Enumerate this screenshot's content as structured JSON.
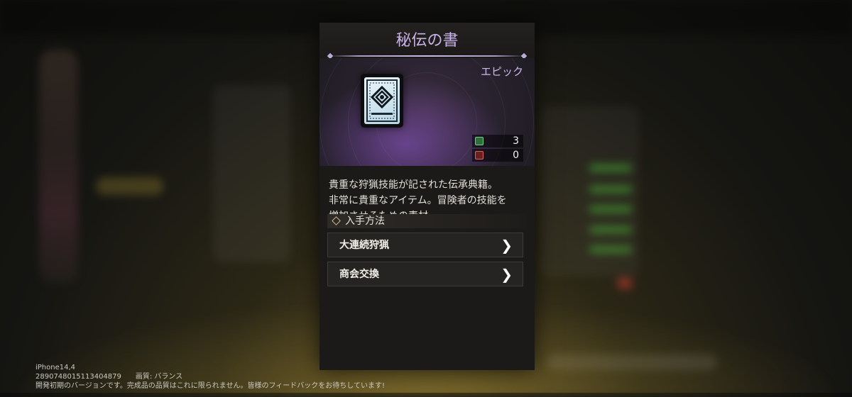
{
  "item": {
    "name": "秘伝の書",
    "rarity": "エピック",
    "counts": [
      {
        "icon": "green-storage-icon",
        "value": "3"
      },
      {
        "icon": "red-storage-icon",
        "value": "0"
      }
    ],
    "description": "貴重な狩猟技能が記された伝承典籍。\n非常に貴重なアイテム。冒険者の技能を\n増加させるための素材"
  },
  "acquisition": {
    "header": "入手方法",
    "options": [
      {
        "label": "大連続狩猟"
      },
      {
        "label": "商会交換"
      }
    ]
  },
  "footer": {
    "device": "iPhone14,4",
    "build": "2890748015113404879　　画質: バランス",
    "notice": "開発初期のバージョンです。完成品の品質はこれに限られません。皆様のフィードバックをお待ちしています!"
  },
  "colors": {
    "title": "#c8b2e6",
    "rarity": "#c9b8ea",
    "background": "#1b1a18"
  }
}
